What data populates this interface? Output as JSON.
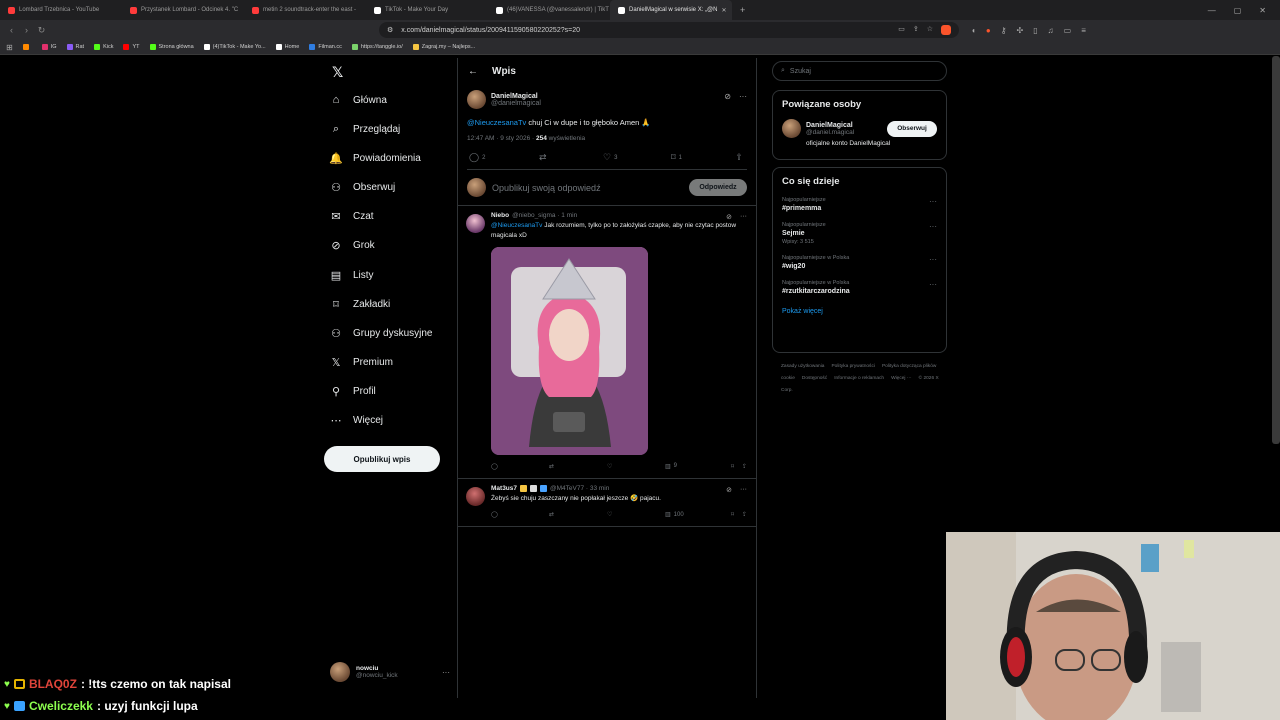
{
  "browser": {
    "tabs": [
      {
        "label": "Lombard Trzebnica - YouTube",
        "color": "#ff3b3b"
      },
      {
        "label": "Przystanek Lombard - Odcinek 4. \"C",
        "color": "#ff3b3b"
      },
      {
        "label": "metin 2 soundtrack-enter the east -",
        "color": "#ff3b3b"
      },
      {
        "label": "TikTok - Make Your Day",
        "color": "#ffffff"
      },
      {
        "label": "(46)VANESSA (@vanessalendr) | TikT",
        "color": "#ffffff"
      },
      {
        "label": "DanielMagical w serwisie X: „@N",
        "color": "#ffffff"
      }
    ],
    "url": "x.com/danielmagical/status/2009411590580220252?s=20",
    "bookmarks": [
      {
        "label": "",
        "color": "#ff8a00"
      },
      {
        "label": "IG",
        "color": "#e1306c"
      },
      {
        "label": "Rat",
        "color": "#8a5cf6"
      },
      {
        "label": "Kick",
        "color": "#53fc18"
      },
      {
        "label": "YT",
        "color": "#ff0000"
      },
      {
        "label": "Strona główna",
        "color": "#53fc18"
      },
      {
        "label": "(4)TikTok - Make Yo...",
        "color": "#ffffff"
      },
      {
        "label": "Home",
        "color": "#ffffff"
      },
      {
        "label": "Filman.cc",
        "color": "#2f7de1"
      },
      {
        "label": "https://tanggle.io/",
        "color": "#7bd36b"
      },
      {
        "label": "Zagraj.my – Najleps...",
        "color": "#f5c542"
      }
    ]
  },
  "nav": {
    "logo": "𝕏",
    "items": [
      {
        "label": "Główna",
        "icon": "⌂"
      },
      {
        "label": "Przeglądaj",
        "icon": "⌕"
      },
      {
        "label": "Powiadomienia",
        "icon": "🔔"
      },
      {
        "label": "Obserwuj",
        "icon": "⚇"
      },
      {
        "label": "Czat",
        "icon": "✉"
      },
      {
        "label": "Grok",
        "icon": "⊘"
      },
      {
        "label": "Listy",
        "icon": "▤"
      },
      {
        "label": "Zakładki",
        "icon": "⌑"
      },
      {
        "label": "Grupy dyskusyjne",
        "icon": "⚇"
      },
      {
        "label": "Premium",
        "icon": "𝕏"
      },
      {
        "label": "Profil",
        "icon": "⚲"
      },
      {
        "label": "Więcej",
        "icon": "⋯"
      }
    ],
    "post_button": "Opublikuj wpis",
    "account": {
      "name": "nowciu",
      "handle": "@nowciu_kick"
    }
  },
  "center": {
    "header": "Wpis",
    "tweet": {
      "name": "DanielMagical",
      "handle": "@danielmagical",
      "mention": "@NieuczesanaTv",
      "text": " chuj Ci w dupe i to głęboko Amen 🙏",
      "time": "12:47 AM · 9 sty 2026 · ",
      "views": "254",
      "views_label": " wyświetlenia",
      "replies": "2",
      "reposts": "",
      "likes": "3",
      "bookmarks": "1"
    },
    "reply_placeholder": "Opublikuj swoją odpowiedź",
    "reply_button": "Odpowiedz",
    "replies": [
      {
        "name": "Niebo",
        "handle": "@niebo_sigma · 1 min",
        "mention": "@NieuczesanaTv",
        "text": " Jak rozumiem, tylko po to założyłaś czapke, aby nie czytac postow magicala xD",
        "views": "9"
      },
      {
        "name": "Mat3us7",
        "handle": "@M4TeV77 · 33 min",
        "text": "Żebyś sie chuju zaszczany nie popłakał jeszcze 🤣 pajacu.",
        "views": "100"
      }
    ]
  },
  "right": {
    "search_placeholder": "Szukaj",
    "related": {
      "title": "Powiązane osoby",
      "name": "DanielMagical",
      "handle": "@daniel.magical",
      "follow": "Obserwuj",
      "bio": "oficjalne konto DanielMagical"
    },
    "trends": {
      "title": "Co się dzieje",
      "items": [
        {
          "context": "Najpopularniejsze",
          "title": "#primemma",
          "count": ""
        },
        {
          "context": "Najpopularniejsze",
          "title": "Sejmie",
          "count": "Wpisy: 3 515"
        },
        {
          "context": "Najpopularniejsze w Polska",
          "title": "#wig20",
          "count": ""
        },
        {
          "context": "Najpopularniejsze w Polska",
          "title": "#rzutkitarczarodzina",
          "count": ""
        }
      ],
      "show_more": "Pokaż więcej"
    },
    "footer": [
      "Zasady użytkowania",
      "Polityka prywatności",
      "Polityka dotycząca plików cookie",
      "Dostępność",
      "Informacje o reklamach",
      "Więcej ···",
      "© 2026 X Corp."
    ]
  },
  "chat_overlay": [
    {
      "user": "BLAQ0Z",
      "message": ": !tts czemo on tak napisal"
    },
    {
      "user": "Cweliczekk",
      "message": ": uzyj funkcji lupa"
    }
  ]
}
